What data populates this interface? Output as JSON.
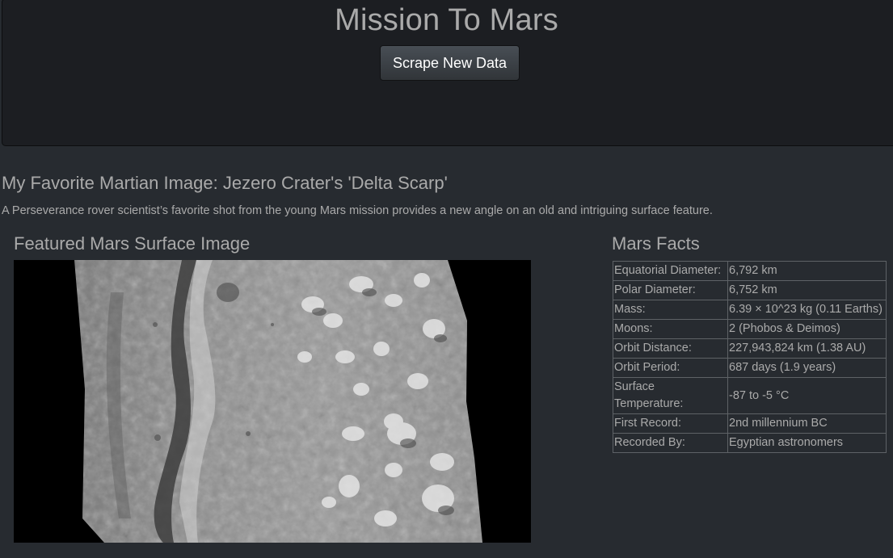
{
  "header": {
    "title": "Mission To Mars",
    "scrape_button_label": "Scrape New Data"
  },
  "news": {
    "title": "My Favorite Martian Image: Jezero Crater's 'Delta Scarp'",
    "paragraph": "A Perseverance rover scientist’s favorite shot from the young Mars mission provides a new angle on an old and intriguing surface feature."
  },
  "featured": {
    "heading": "Featured Mars Surface Image"
  },
  "facts": {
    "heading": "Mars Facts",
    "rows": [
      {
        "label": "Equatorial Diameter:",
        "value": "6,792 km"
      },
      {
        "label": "Polar Diameter:",
        "value": "6,752 km"
      },
      {
        "label": "Mass:",
        "value": "6.39 × 10^23 kg (0.11 Earths)"
      },
      {
        "label": "Moons:",
        "value": "2 (Phobos & Deimos)"
      },
      {
        "label": "Orbit Distance:",
        "value": "227,943,824 km (1.38 AU)"
      },
      {
        "label": "Orbit Period:",
        "value": "687 days (1.9 years)"
      },
      {
        "label": "Surface Temperature:",
        "value": "-87 to -5 °C"
      },
      {
        "label": "First Record:",
        "value": "2nd millennium BC"
      },
      {
        "label": "Recorded By:",
        "value": "Egyptian astronomers"
      }
    ]
  }
}
